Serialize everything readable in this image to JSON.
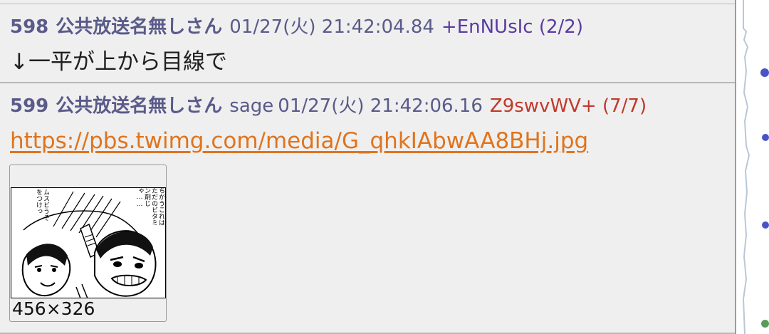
{
  "colors": {
    "header": "#5a5a8a",
    "uid_blue": "#5b3aa0",
    "uid_red": "#c0392b",
    "link": "#e0741d",
    "background": "#efefef"
  },
  "posts": [
    {
      "number": "598",
      "name": "公共放送名無しさん",
      "mail": "",
      "date": "01/27(火) 21:42:04.84",
      "uid": "+EnNUsIc (2/2)",
      "body": "↓一平が上から目線で"
    },
    {
      "number": "599",
      "name": "公共放送名無しさん",
      "mail": "sage",
      "date": "01/27(火) 21:42:06.16",
      "uid": "Z9swvWV+ (7/7)",
      "link": "https://pbs.twimg.com/media/G_qhkIAbwAA8BHj.jpg",
      "thumbnail": {
        "size_label": "456×326",
        "bubbles": [
          "ちがう",
          "これは",
          "ただの",
          "ビタミン剤",
          "じゃ……",
          "ムスビ",
          "うそを",
          "つけっ"
        ]
      }
    }
  ],
  "scrollbar": {
    "markers": [
      "blue-dot",
      "blue-dot",
      "blue-dot",
      "green-dot"
    ]
  }
}
